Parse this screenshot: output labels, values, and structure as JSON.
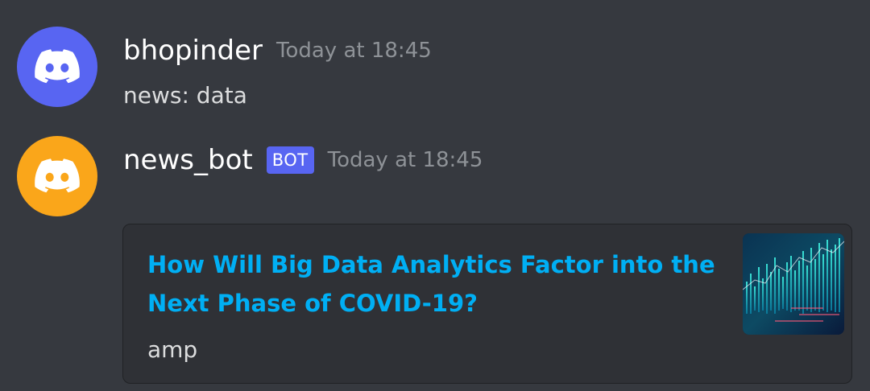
{
  "messages": [
    {
      "username": "bhopinder",
      "timestamp": "Today at 18:45",
      "content": "news: data",
      "avatar_color": "#5865f2",
      "avatar_icon": "discord-logo-icon"
    },
    {
      "username": "news_bot",
      "bot_tag": "BOT",
      "timestamp": "Today at 18:45",
      "avatar_color": "#faa61a",
      "avatar_icon": "discord-logo-icon",
      "embed": {
        "title": "How Will Big Data Analytics Factor into the Next Phase of COVID-19?",
        "description": "amp",
        "thumbnail": "data-chart-thumbnail"
      }
    }
  ],
  "colors": {
    "background": "#36393f",
    "embed_background": "#2f3136",
    "link": "#00aff4",
    "bot_tag": "#5865f2",
    "timestamp": "#8e9297"
  }
}
